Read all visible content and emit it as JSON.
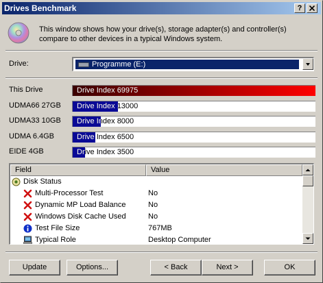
{
  "window": {
    "title": "Drives Benchmark",
    "help_btn": "?",
    "close_btn": "X"
  },
  "intro": "This window shows how your drive(s), storage adapter(s) and controller(s) compare to other devices in a typical Windows system.",
  "drive": {
    "label": "Drive:",
    "selected": "Programme (E:)"
  },
  "benchmarks": [
    {
      "name": "This Drive",
      "label": "Drive Index 69975",
      "index": 69975,
      "color": "red"
    },
    {
      "name": "UDMA66 27GB",
      "label": "Drive Index 13000",
      "index": 13000,
      "color": "blue"
    },
    {
      "name": "UDMA33 10GB",
      "label": "Drive Index 8000",
      "index": 8000,
      "color": "blue"
    },
    {
      "name": "UDMA 6.4GB",
      "label": "Drive Index 6500",
      "index": 6500,
      "color": "blue"
    },
    {
      "name": "EIDE 4GB",
      "label": "Drive Index 3500",
      "index": 3500,
      "color": "blue"
    }
  ],
  "bar_max_index": 69975,
  "table": {
    "headers": [
      "Field",
      "Value"
    ],
    "rows": [
      {
        "field": "Disk Status",
        "value": "",
        "icon": "disk-status-icon",
        "indent": 0
      },
      {
        "field": "Multi-Processor Test",
        "value": "No",
        "icon": "red-x-icon",
        "indent": 1
      },
      {
        "field": "Dynamic MP Load Balance",
        "value": "No",
        "icon": "red-x-icon",
        "indent": 1
      },
      {
        "field": "Windows Disk Cache Used",
        "value": "No",
        "icon": "red-x-icon",
        "indent": 1
      },
      {
        "field": "Test File Size",
        "value": "767MB",
        "icon": "info-icon",
        "indent": 1
      },
      {
        "field": "Typical Role",
        "value": "Desktop Computer",
        "icon": "computer-icon",
        "indent": 1
      }
    ]
  },
  "buttons": {
    "update": "Update",
    "options": "Options...",
    "back": "< Back",
    "next": "Next >",
    "ok": "OK"
  },
  "colors": {
    "title_start": "#0a246a",
    "title_end": "#a6caf0",
    "this_drive_bar": "#ff0000",
    "reference_bar": "#0a0a96",
    "selection": "#0a246a"
  }
}
